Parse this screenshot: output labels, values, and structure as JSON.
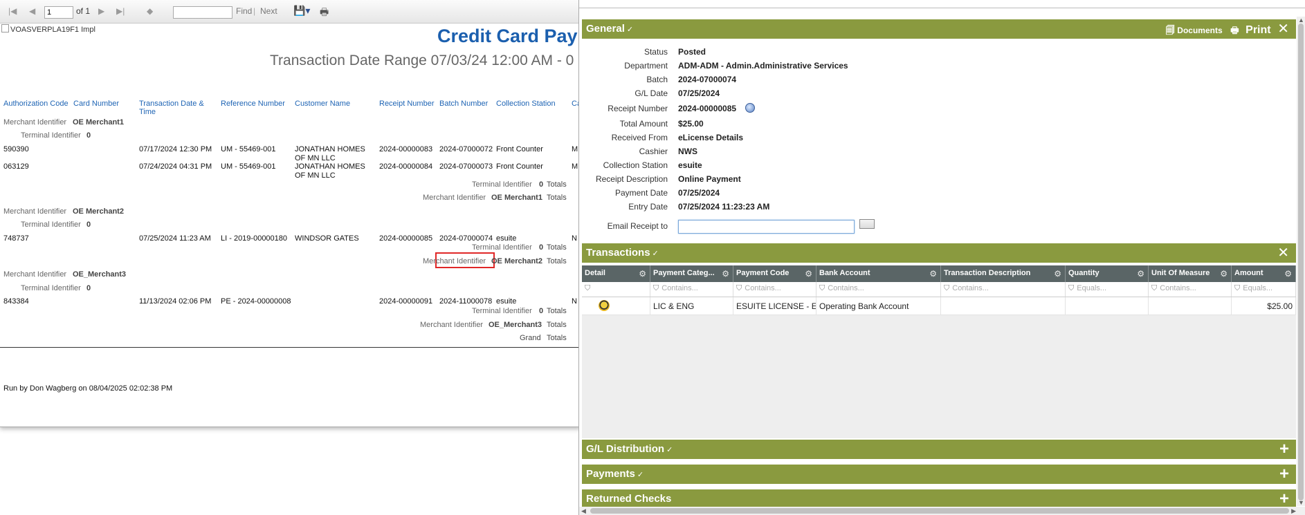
{
  "toolbar": {
    "page_value": "1",
    "page_of": "of 1",
    "find_label": "Find",
    "next_label": "Next"
  },
  "report": {
    "broken_image_alt": "VOASVERPLA19F1 Impl",
    "title": "Credit Card Pay",
    "subtitle": "Transaction Date Range 07/03/24 12:00 AM - 0",
    "columns": [
      "Authorization Code",
      "Card Number",
      "Transaction Date &\nTime",
      "Reference Number",
      "Customer Name",
      "Receipt Number",
      "Batch Number",
      "Collection Station",
      "Ca"
    ],
    "merchant_label": "Merchant Identifier",
    "terminal_label": "Terminal Identifier",
    "totals_label": "Totals",
    "grand_label": "Grand",
    "groups": [
      {
        "merchant": "OE Merchant1",
        "terminal": "0",
        "rows": [
          {
            "auth": "590390",
            "date": "07/17/2024 12:30 PM",
            "ref": "UM - 55469-001",
            "customer": "JONATHAN HOMES OF MN LLC",
            "receipt": "2024-00000083",
            "batch": "2024-07000072",
            "station": "Front Counter",
            "ca": "M"
          },
          {
            "auth": "063129",
            "date": "07/24/2024 04:31 PM",
            "ref": "UM - 55469-001",
            "customer": "JONATHAN HOMES OF MN LLC",
            "receipt": "2024-00000084",
            "batch": "2024-07000073",
            "station": "Front Counter",
            "ca": "M"
          }
        ]
      },
      {
        "merchant": "OE Merchant2",
        "terminal": "0",
        "rows": [
          {
            "auth": "748737",
            "date": "07/25/2024 11:23 AM",
            "ref": "LI - 2019-00000180",
            "customer": "WINDSOR GATES",
            "receipt": "2024-00000085",
            "batch": "2024-07000074",
            "station": "esuite",
            "ca": "N"
          }
        ]
      },
      {
        "merchant": "OE_Merchant3",
        "terminal": "0",
        "rows": [
          {
            "auth": "843384",
            "date": "11/13/2024 02:06 PM",
            "ref": "PE - 2024-00000008",
            "customer": "",
            "receipt": "2024-00000091",
            "batch": "2024-11000078",
            "station": "esuite",
            "ca": "N"
          }
        ]
      }
    ],
    "run_by": "Run by Don Wagberg on 08/04/2025 02:02:38 PM"
  },
  "panel": {
    "general": {
      "title": "General",
      "check": "✓",
      "documents_label": "Documents",
      "print_label": "Print",
      "fields": [
        {
          "label": "Status",
          "value": "Posted"
        },
        {
          "label": "Department",
          "value": "ADM-ADM - Admin.Administrative Services"
        },
        {
          "label": "Batch",
          "value": "2024-07000074"
        },
        {
          "label": "G/L Date",
          "value": "07/25/2024"
        },
        {
          "label": "Receipt Number",
          "value": "2024-00000085"
        },
        {
          "label": "Total Amount",
          "value": "$25.00"
        },
        {
          "label": "Received From",
          "value": "eLicense Details"
        },
        {
          "label": "Cashier",
          "value": "NWS"
        },
        {
          "label": "Collection Station",
          "value": "esuite"
        },
        {
          "label": "Receipt Description",
          "value": "Online Payment"
        },
        {
          "label": "Payment Date",
          "value": "07/25/2024"
        },
        {
          "label": "Entry Date",
          "value": "07/25/2024 11:23:23 AM"
        }
      ],
      "email_label": "Email Receipt to",
      "email_value": ""
    },
    "transactions": {
      "title": "Transactions",
      "columns": [
        "Detail",
        "Payment Categ...",
        "Payment Code",
        "Bank Account",
        "Transaction Description",
        "Quantity",
        "Unit Of Measure",
        "Amount"
      ],
      "filters": [
        "",
        "Contains...",
        "Contains...",
        "Contains...",
        "Contains...",
        "Equals...",
        "Contains...",
        "Equals..."
      ],
      "rows": [
        {
          "category": "LIC & ENG",
          "code": "ESUITE LICENSE - Esu",
          "bank": "Operating Bank Account",
          "description": "",
          "quantity": "",
          "uom": "",
          "amount": "$25.00"
        }
      ]
    },
    "sections": [
      {
        "title": "G/L Distribution"
      },
      {
        "title": "Payments"
      },
      {
        "title": "Returned Checks"
      }
    ]
  },
  "colors": {
    "section_header": "#8a9a3f",
    "grid_header": "#5a6566",
    "report_title": "#1b5fae",
    "highlight": "#e02727"
  }
}
